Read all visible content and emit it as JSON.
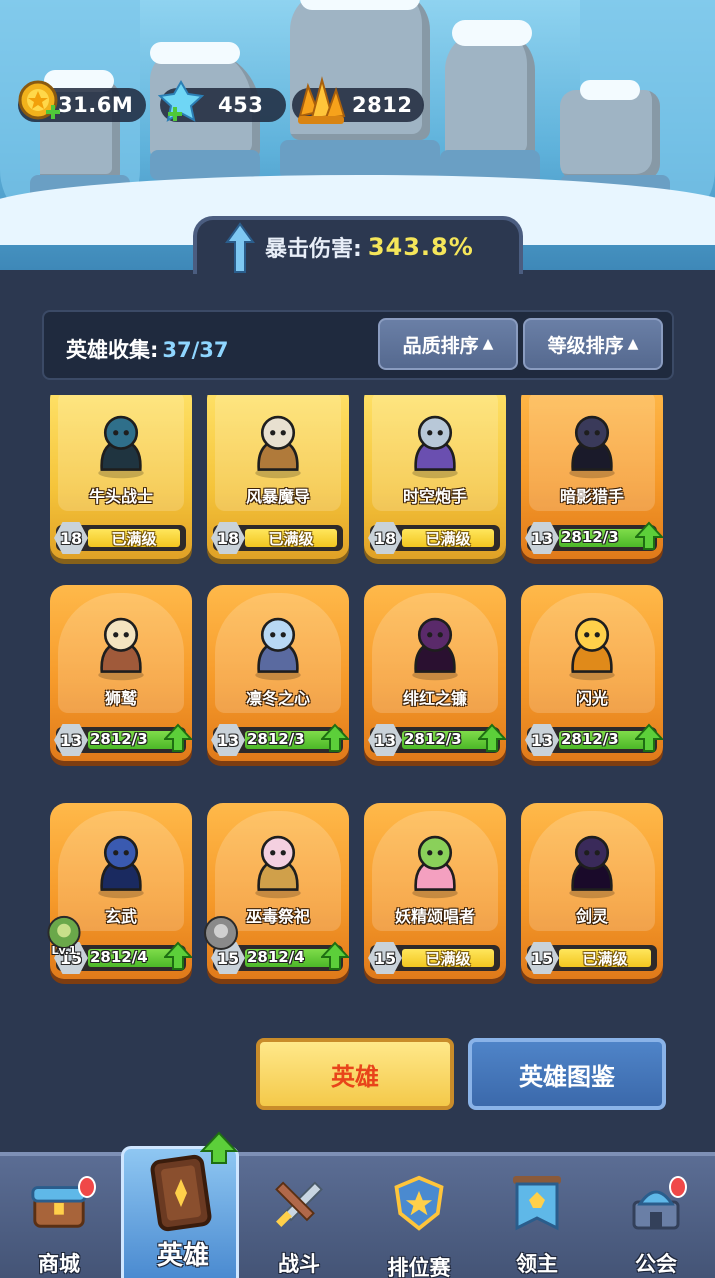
{
  "currency": {
    "gold": {
      "value": "31.6M",
      "icon": "gold-coin-icon"
    },
    "gems": {
      "value": "453",
      "icon": "blue-gem-icon"
    },
    "crystals": {
      "value": "2812",
      "icon": "orange-crystal-icon"
    }
  },
  "crit_bonus": {
    "label": "暴击伤害:",
    "value": "343.8%"
  },
  "collection": {
    "label": "英雄收集:",
    "count": "37/37"
  },
  "sort": {
    "quality": "品质排序",
    "level": "等级排序",
    "indicator": "▲"
  },
  "heroes": [
    {
      "name": "牛头战士",
      "level": "18",
      "status": "已满级",
      "rarity": "gold"
    },
    {
      "name": "风暴魔导",
      "level": "18",
      "status": "已满级",
      "rarity": "gold"
    },
    {
      "name": "时空炮手",
      "level": "18",
      "status": "已满级",
      "rarity": "gold"
    },
    {
      "name": "暗影猎手",
      "level": "13",
      "status": "2812/3",
      "rarity": "orange",
      "upgradable": true
    },
    {
      "name": "狮鹫",
      "level": "13",
      "status": "2812/3",
      "rarity": "orange",
      "upgradable": true
    },
    {
      "name": "凛冬之心",
      "level": "13",
      "status": "2812/3",
      "rarity": "orange",
      "upgradable": true
    },
    {
      "name": "绯红之镰",
      "level": "13",
      "status": "2812/3",
      "rarity": "orange",
      "upgradable": true
    },
    {
      "name": "闪光",
      "level": "13",
      "status": "2812/3",
      "rarity": "orange",
      "upgradable": true
    },
    {
      "name": "玄武",
      "level": "15",
      "status": "2812/4",
      "rarity": "orange",
      "upgradable": true,
      "lord_badge": "Lv.1"
    },
    {
      "name": "巫毒祭祀",
      "level": "15",
      "status": "2812/4",
      "rarity": "orange",
      "upgradable": true,
      "lord_badge": ""
    },
    {
      "name": "妖精颂唱者",
      "level": "15",
      "status": "已满级",
      "rarity": "orange"
    },
    {
      "name": "剑灵",
      "level": "15",
      "status": "已满级",
      "rarity": "orange"
    }
  ],
  "actions": {
    "heroes": "英雄",
    "codex": "英雄图鉴"
  },
  "nav": [
    {
      "label": "商城",
      "icon": "shop-chest-icon"
    },
    {
      "label": "英雄",
      "icon": "hero-card-icon"
    },
    {
      "label": "战斗",
      "icon": "crossed-swords-icon"
    },
    {
      "label": "排位赛",
      "icon": "ranked-shield-icon"
    },
    {
      "label": "领主",
      "icon": "lord-banner-icon"
    },
    {
      "label": "公会",
      "icon": "guild-tower-icon"
    }
  ],
  "colors": {
    "accent_yellow": "#f5e65a",
    "accent_blue": "#8fd6ff",
    "bg": "#2c3850"
  }
}
